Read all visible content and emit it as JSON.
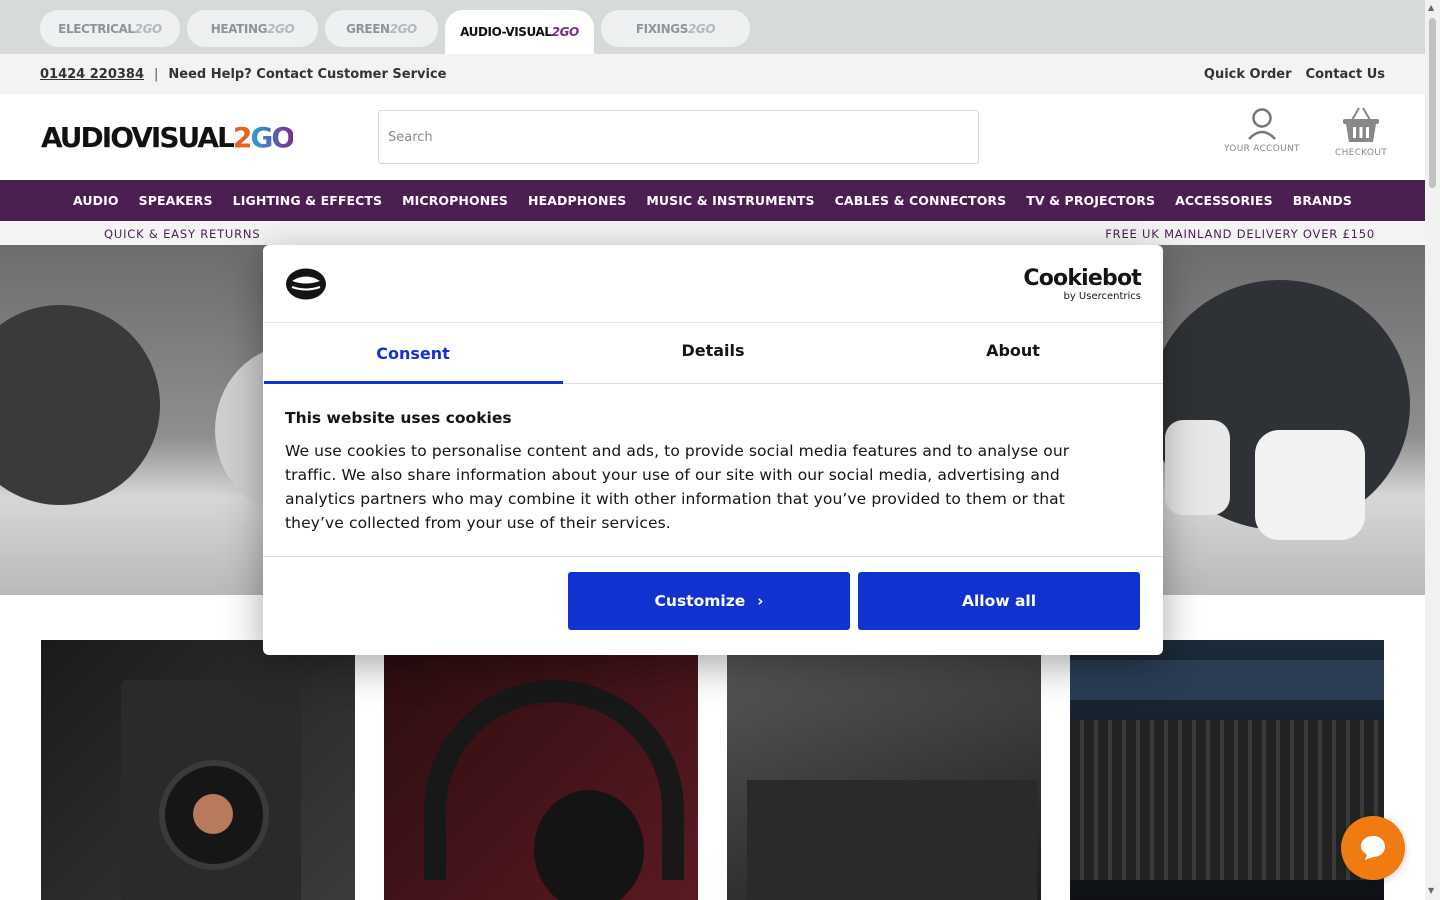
{
  "site_tabs": [
    {
      "main": "ELECTRICAL",
      "sub": "2GO"
    },
    {
      "main": "HEATING",
      "sub": "2GO"
    },
    {
      "main": "GREEN",
      "sub": "2GO"
    },
    {
      "main": "AUDIO-VISUAL",
      "sub": "2GO"
    },
    {
      "main": "FIXINGS",
      "sub": "2GO"
    }
  ],
  "help_bar": {
    "phone": "01424 220384",
    "help_text": "Need Help? Contact Customer Service",
    "quick_order": "Quick Order",
    "contact_us": "Contact Us"
  },
  "header": {
    "logo_main": "AUDIOVISUAL",
    "logo_two": "2",
    "logo_go": "GO",
    "search_placeholder": "Search",
    "account_label": "YOUR ACCOUNT",
    "checkout_label": "CHECKOUT"
  },
  "nav": [
    "AUDIO",
    "SPEAKERS",
    "LIGHTING & EFFECTS",
    "MICROPHONES",
    "HEADPHONES",
    "MUSIC & INSTRUMENTS",
    "CABLES & CONNECTORS",
    "TV & PROJECTORS",
    "ACCESSORIES",
    "BRANDS"
  ],
  "usp": {
    "left": "QUICK & EASY RETURNS",
    "right": "FREE UK MAINLAND DELIVERY OVER £150"
  },
  "cookie_dialog": {
    "brand_big": "Cookiebot",
    "brand_small": "by Usercentrics",
    "tabs": [
      "Consent",
      "Details",
      "About"
    ],
    "title": "This website uses cookies",
    "body": "We use cookies to personalise content and ads, to provide social media features and to analyse our traffic. We also share information about your use of our site with our social media, advertising and analytics partners who may combine it with other information that you’ve provided to them or that they’ve collected from your use of their services.",
    "customize": "Customize",
    "allow_all": "Allow all"
  },
  "colors": {
    "nav_bg": "#4b1f52",
    "cookie_blue": "#1032cf",
    "chat_orange": "#f07b10"
  },
  "icons": [
    "user-icon",
    "basket-icon",
    "chevron-right-icon",
    "chat-icon",
    "cookie-logo-icon"
  ]
}
